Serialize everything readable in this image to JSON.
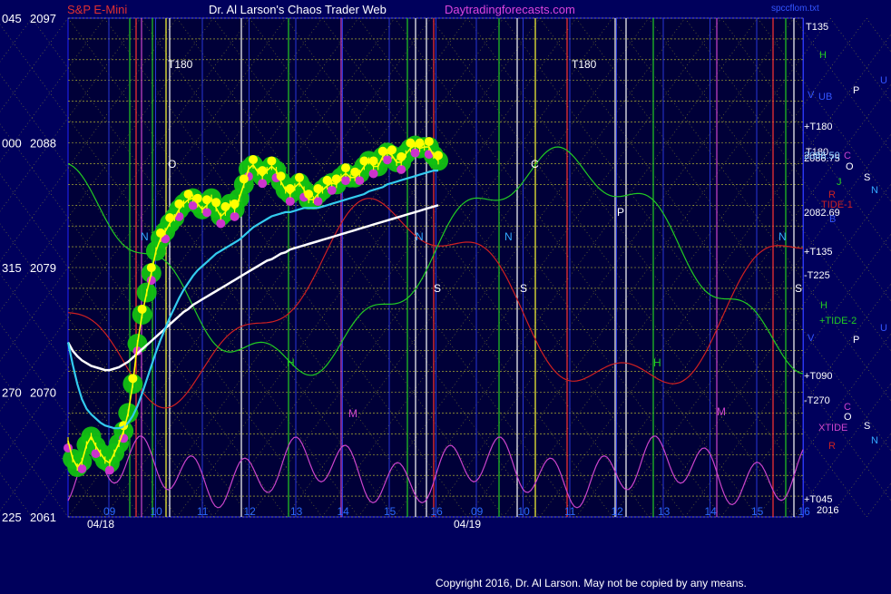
{
  "header": {
    "instrument": "S&P E-Mini",
    "title": "Dr. Al Larson's Chaos Trader Web",
    "site": "Daytradingforecasts.com",
    "right_label": "spccflom.txt"
  },
  "footer": {
    "copyright": "Copyright 2016, Dr. Al Larson. May not be copied by any means."
  },
  "colors": {
    "background": "#00005c",
    "plot_bg": "#000040",
    "price_bars": "#ffff00",
    "volatility_blobs": "#12c012",
    "magenta_dots": "#cc33cc",
    "ema_cyan": "#33ccee",
    "ma_white": "#ffffff",
    "red_cycle": "#d02020",
    "green_cycle": "#22cc22",
    "purple_xtide": "#cc44cc",
    "frame": "#2222ff"
  },
  "chart_data": {
    "type": "line",
    "title": "S&P E-Mini",
    "y_axis_ticks": [
      {
        "code": "045",
        "price": "2097"
      },
      {
        "code": "000",
        "price": "2088"
      },
      {
        "code": "315",
        "price": "2079"
      },
      {
        "code": "270",
        "price": "2070"
      },
      {
        "code": "225",
        "price": "2061"
      }
    ],
    "ylim": [
      2061,
      2097
    ],
    "x_hour_labels": [
      "09",
      "10",
      "11",
      "12",
      "13",
      "14",
      "15",
      "16",
      "09",
      "10",
      "11",
      "12",
      "13",
      "14",
      "15",
      "16"
    ],
    "x_date_labels": [
      "04/18",
      "04/19"
    ],
    "day1_price_x": [
      0,
      1,
      2,
      3,
      4,
      5,
      6,
      7,
      8,
      9,
      10,
      11,
      12,
      13,
      14,
      15,
      16,
      17,
      18,
      19,
      20,
      21,
      22,
      23,
      24,
      25,
      26,
      27,
      28,
      29,
      30,
      31,
      32,
      33,
      34,
      35,
      36,
      37,
      38,
      39,
      40,
      41,
      42,
      43,
      44,
      45,
      46,
      47,
      48,
      49,
      50,
      51,
      52,
      53,
      54,
      55,
      56,
      57,
      58,
      59,
      60,
      61,
      62,
      63,
      64,
      65,
      66,
      67,
      68,
      69,
      70,
      71,
      72,
      73,
      74,
      75,
      76,
      77,
      78,
      79,
      80
    ],
    "day1_price": [
      2066.5,
      2065.2,
      2064.6,
      2065.0,
      2066.2,
      2066.8,
      2066.1,
      2065.6,
      2065.1,
      2064.9,
      2065.6,
      2066.3,
      2067.2,
      2068.5,
      2070.6,
      2073.5,
      2075.6,
      2077.2,
      2078.6,
      2080.2,
      2081.1,
      2081.6,
      2082.2,
      2082.6,
      2083.2,
      2083.6,
      2083.9,
      2084.0,
      2083.6,
      2083.2,
      2083.5,
      2084.0,
      2083.3,
      2082.7,
      2083.0,
      2083.6,
      2083.2,
      2084.0,
      2085.0,
      2086.1,
      2086.4,
      2085.9,
      2085.6,
      2086.0,
      2086.3,
      2086.0,
      2085.2,
      2084.6,
      2084.3,
      2084.8,
      2085.1,
      2084.6,
      2083.9,
      2083.9,
      2084.3,
      2084.6,
      2084.9,
      2085.1,
      2085.0,
      2085.5,
      2085.8,
      2085.5,
      2085.5,
      2085.8,
      2086.3,
      2086.7,
      2086.3,
      2086.3,
      2087.0,
      2087.3,
      2087.1,
      2086.6,
      2086.6,
      2087.2,
      2087.6,
      2087.8,
      2087.6,
      2087.7,
      2087.7,
      2087.1,
      2086.7
    ],
    "cyan_ema": [
      2073.6,
      2072.0,
      2070.6,
      2069.5,
      2068.8,
      2068.4,
      2068.1,
      2067.8,
      2067.6,
      2067.5,
      2067.4,
      2067.4,
      2067.5,
      2067.8,
      2068.3,
      2069.0,
      2069.9,
      2070.9,
      2071.9,
      2072.9,
      2073.8,
      2074.6,
      2075.4,
      2076.1,
      2076.8,
      2077.4,
      2077.9,
      2078.4,
      2078.8,
      2079.1,
      2079.4,
      2079.7,
      2080.0,
      2080.2,
      2080.4,
      2080.6,
      2080.8,
      2081.0,
      2081.3,
      2081.6,
      2081.9,
      2082.1,
      2082.3,
      2082.5,
      2082.7,
      2082.8,
      2082.9,
      2083.0,
      2083.0,
      2083.1,
      2083.2,
      2083.3,
      2083.3,
      2083.3,
      2083.3,
      2083.4,
      2083.5,
      2083.6,
      2083.7,
      2083.8,
      2083.9,
      2084.0,
      2084.1,
      2084.2,
      2084.3,
      2084.5,
      2084.6,
      2084.7,
      2084.8,
      2085.0,
      2085.1,
      2085.2,
      2085.3,
      2085.4,
      2085.5,
      2085.6,
      2085.7,
      2085.8,
      2085.9,
      2086.0,
      2086.0
    ],
    "white_ma": [
      2073.6,
      2073.0,
      2072.6,
      2072.3,
      2072.1,
      2071.9,
      2071.8,
      2071.7,
      2071.6,
      2071.6,
      2071.7,
      2071.8,
      2072.0,
      2072.2,
      2072.5,
      2072.8,
      2073.1,
      2073.4,
      2073.7,
      2074.0,
      2074.3,
      2074.6,
      2074.9,
      2075.2,
      2075.5,
      2075.8,
      2076.0,
      2076.3,
      2076.5,
      2076.7,
      2076.9,
      2077.1,
      2077.3,
      2077.5,
      2077.7,
      2077.9,
      2078.1,
      2078.3,
      2078.5,
      2078.7,
      2078.9,
      2079.1,
      2079.3,
      2079.5,
      2079.6,
      2079.8,
      2080.0,
      2080.1,
      2080.3,
      2080.4,
      2080.5,
      2080.6,
      2080.7,
      2080.8,
      2080.9,
      2081.0,
      2081.1,
      2081.2,
      2081.3,
      2081.4,
      2081.5,
      2081.6,
      2081.7,
      2081.8,
      2081.9,
      2082.0,
      2082.1,
      2082.2,
      2082.3,
      2082.4,
      2082.5,
      2082.6,
      2082.7,
      2082.8,
      2082.9,
      2083.0,
      2083.1,
      2083.2,
      2083.3,
      2083.4,
      2083.5
    ],
    "right_labels": [
      {
        "text": "T135",
        "color": "#ffffff"
      },
      {
        "text": "H",
        "color": "#22cc22"
      },
      {
        "text": "UB",
        "color": "#3355ff"
      },
      {
        "text": "V",
        "color": "#3355ff"
      },
      {
        "text": "P",
        "color": "#ffffff"
      },
      {
        "text": "U",
        "color": "#3355ff"
      },
      {
        "text": "+T180",
        "color": "#ffffff"
      },
      {
        "text": "T180",
        "color": "#ffffff"
      },
      {
        "text": "2086.75",
        "color": "#ffffff"
      },
      {
        "text": "2086.50",
        "color": "#88ccff"
      },
      {
        "text": "C",
        "color": "#cc44cc"
      },
      {
        "text": "O",
        "color": "#ffffff"
      },
      {
        "text": "S",
        "color": "#ffffff"
      },
      {
        "text": "N",
        "color": "#33aaff"
      },
      {
        "text": "J",
        "color": "#22cc22"
      },
      {
        "text": "R",
        "color": "#cc2222"
      },
      {
        "text": "TIDE-1",
        "color": "#cc2222"
      },
      {
        "text": "2082.69",
        "color": "#ffffff"
      },
      {
        "text": "B",
        "color": "#3355ff"
      },
      {
        "text": "+T135",
        "color": "#ffffff"
      },
      {
        "text": "-T225",
        "color": "#ffffff"
      },
      {
        "text": "H",
        "color": "#22cc22"
      },
      {
        "text": "+TIDE-2",
        "color": "#22cc22"
      },
      {
        "text": "V",
        "color": "#3355ff"
      },
      {
        "text": "P",
        "color": "#ffffff"
      },
      {
        "text": "U",
        "color": "#3355ff"
      },
      {
        "text": "+T090",
        "color": "#ffffff"
      },
      {
        "text": "-T270",
        "color": "#ffffff"
      },
      {
        "text": "C",
        "color": "#cc44cc"
      },
      {
        "text": "O",
        "color": "#ffffff"
      },
      {
        "text": "XTIDE",
        "color": "#cc44cc"
      },
      {
        "text": "S",
        "color": "#ffffff"
      },
      {
        "text": "N",
        "color": "#33aaff"
      },
      {
        "text": "R",
        "color": "#cc2222"
      },
      {
        "text": "+T045",
        "color": "#ffffff"
      },
      {
        "text": "2016",
        "color": "#ffffff"
      }
    ],
    "grid": true
  }
}
